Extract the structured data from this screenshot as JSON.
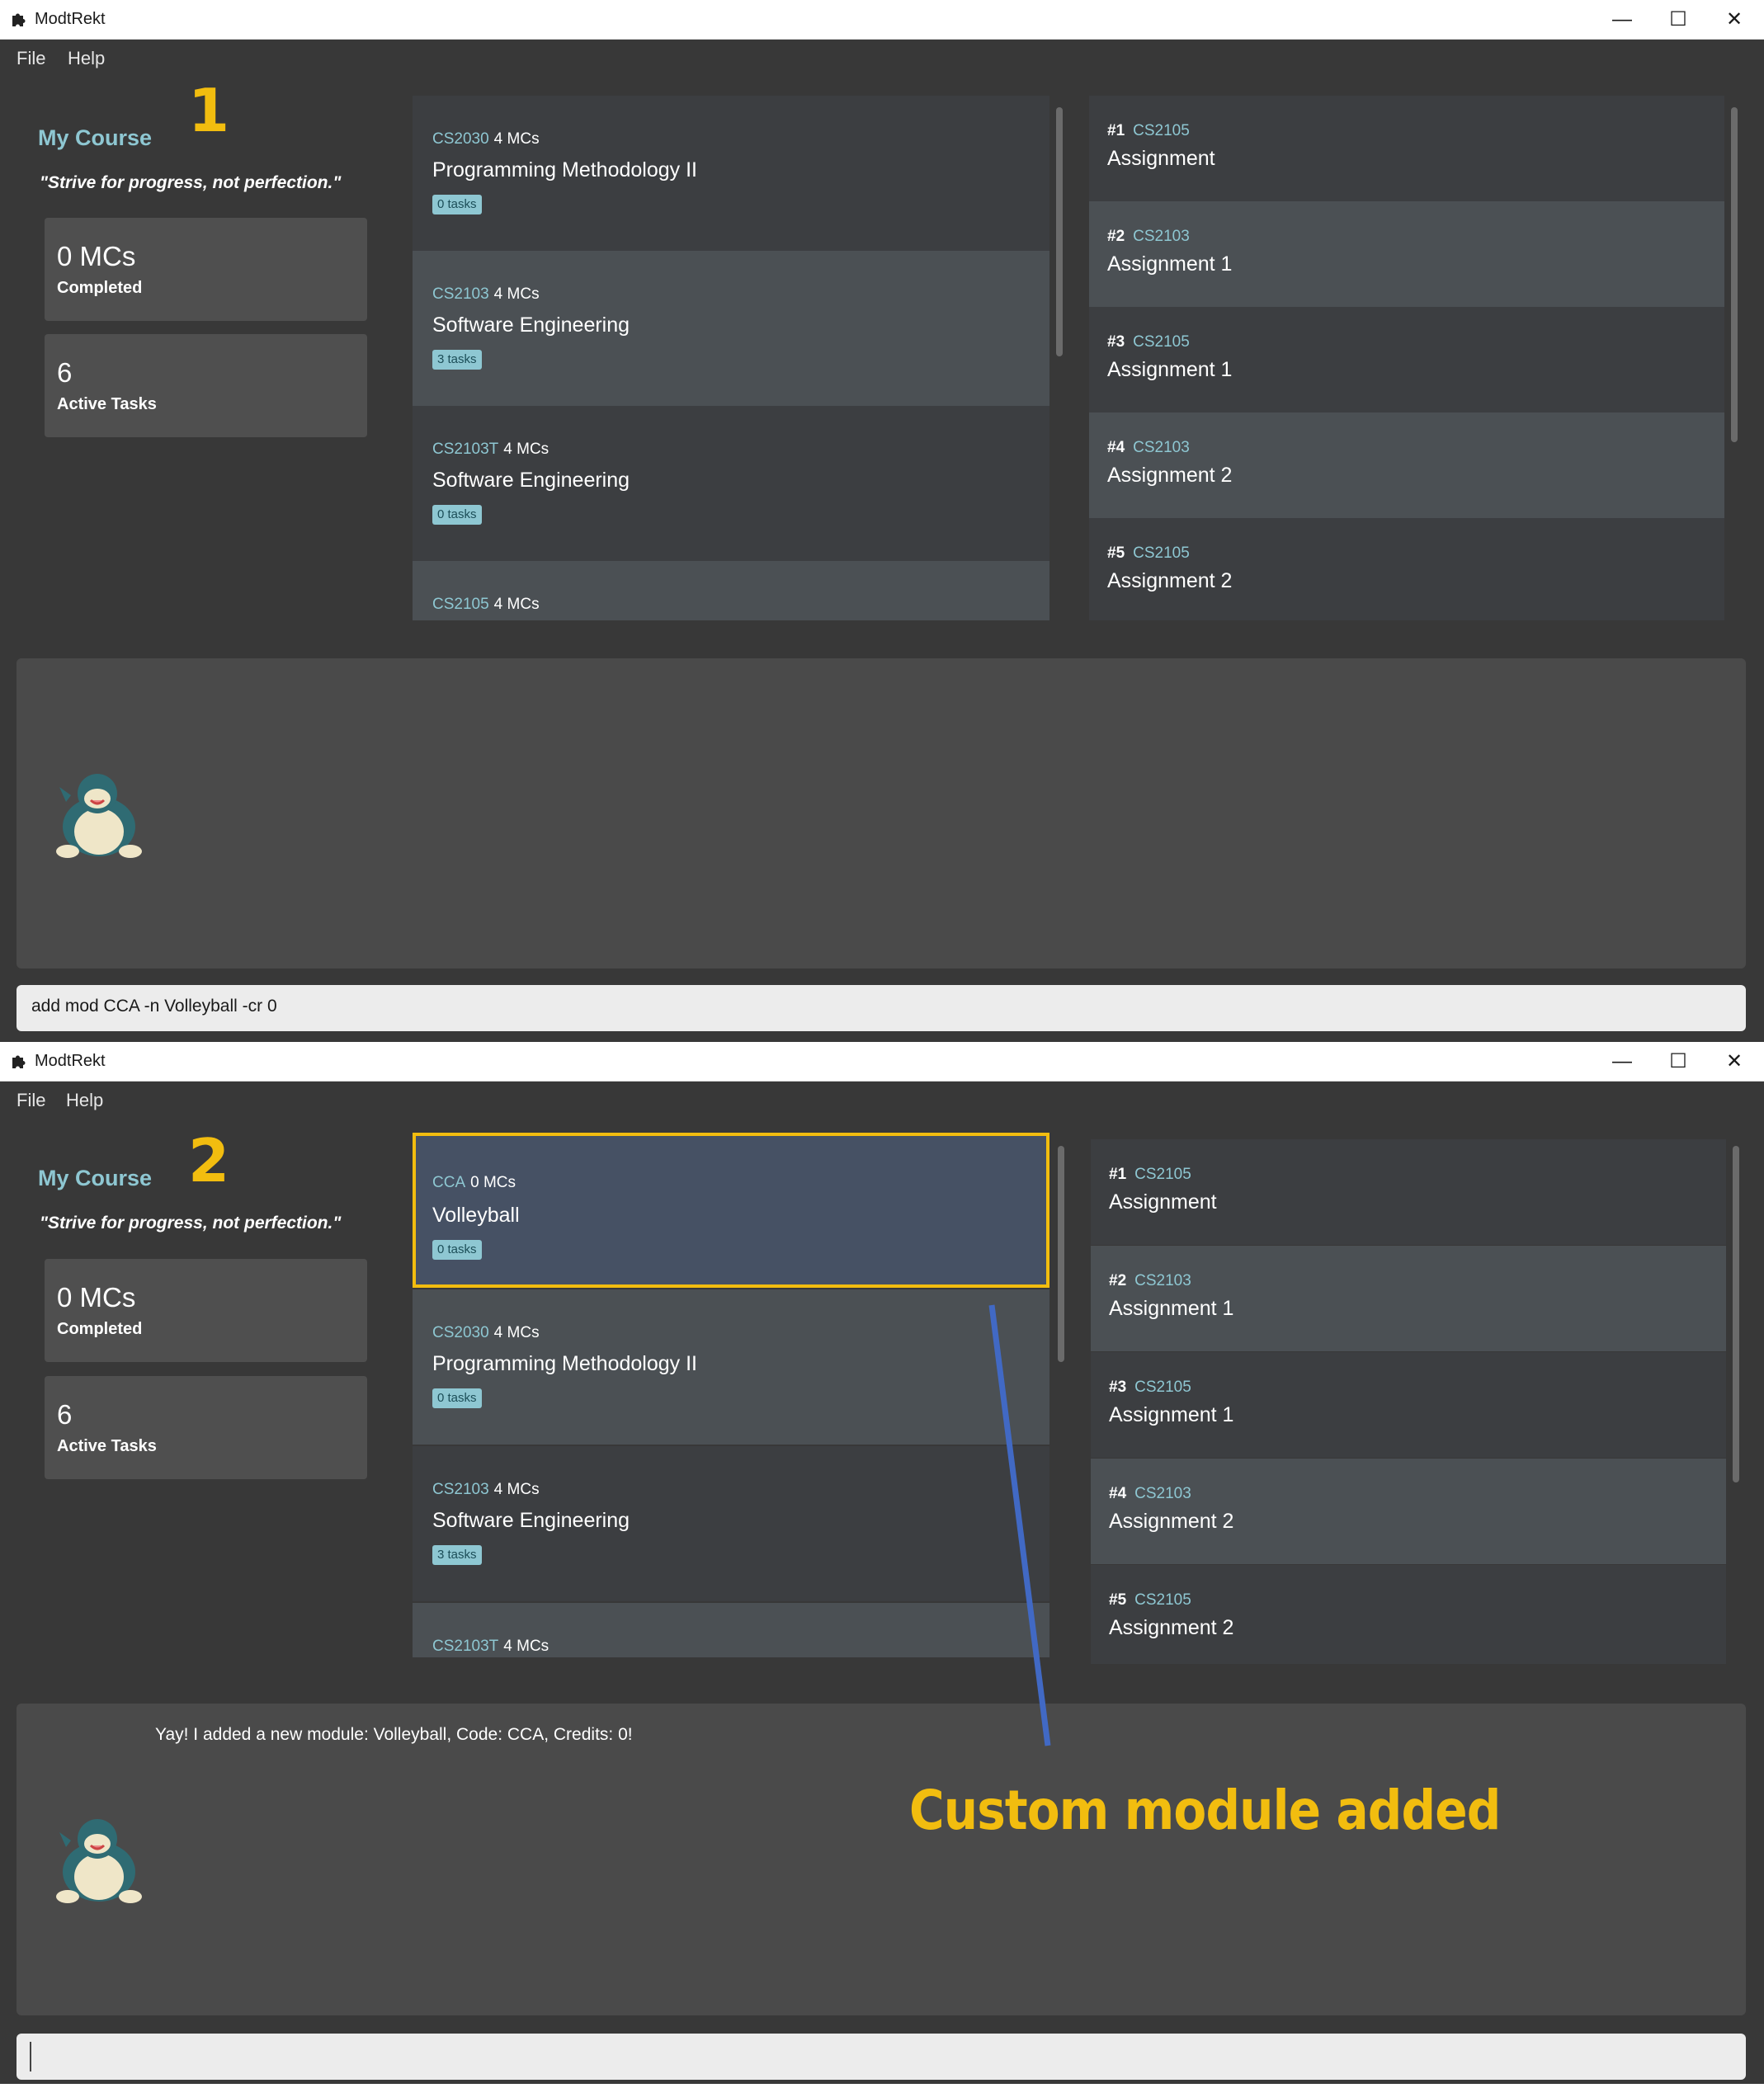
{
  "window": {
    "title": "ModtRekt",
    "minimize_glyph": "—",
    "maximize_glyph": "☐",
    "close_glyph": "✕"
  },
  "menu": {
    "file": "File",
    "help": "Help"
  },
  "sidebar": {
    "title": "My Course",
    "quote": "\"Strive for progress, not perfection.\"",
    "mcs_value": "0 MCs",
    "mcs_label": "Completed",
    "tasks_value": "6",
    "tasks_label": "Active Tasks"
  },
  "steps": {
    "first": "1",
    "second": "2"
  },
  "screen1": {
    "modules": [
      {
        "code": "CS2030",
        "mcs": "4 MCs",
        "name": "Programming Methodology II",
        "tag": "0 tasks"
      },
      {
        "code": "CS2103",
        "mcs": "4 MCs",
        "name": "Software Engineering",
        "tag": "3 tasks"
      },
      {
        "code": "CS2103T",
        "mcs": "4 MCs",
        "name": "Software Engineering",
        "tag": "0 tasks"
      },
      {
        "code": "CS2105",
        "mcs": "4 MCs",
        "name": "",
        "tag": ""
      }
    ],
    "result": "",
    "command": "add mod CCA -n Volleyball -cr 0"
  },
  "screen2": {
    "modules": [
      {
        "code": "CCA",
        "mcs": "0 MCs",
        "name": "Volleyball",
        "tag": "0 tasks"
      },
      {
        "code": "CS2030",
        "mcs": "4 MCs",
        "name": "Programming Methodology II",
        "tag": "0 tasks"
      },
      {
        "code": "CS2103",
        "mcs": "4 MCs",
        "name": "Software Engineering",
        "tag": "3 tasks"
      },
      {
        "code": "CS2103T",
        "mcs": "4 MCs",
        "name": "",
        "tag": ""
      }
    ],
    "result": "Yay! I added a new module: Volleyball, Code: CCA, Credits: 0!",
    "command": ""
  },
  "tasks": [
    {
      "num": "#1",
      "code": "CS2105",
      "name": "Assignment"
    },
    {
      "num": "#2",
      "code": "CS2103",
      "name": "Assignment 1"
    },
    {
      "num": "#3",
      "code": "CS2105",
      "name": "Assignment 1"
    },
    {
      "num": "#4",
      "code": "CS2103",
      "name": "Assignment 2"
    },
    {
      "num": "#5",
      "code": "CS2105",
      "name": "Assignment 2"
    }
  ],
  "annotation": {
    "label": "Custom module added"
  },
  "colors": {
    "accent_yellow": "#f2bd0f",
    "accent_teal": "#8ec7d2",
    "arrow_blue": "#4169c4",
    "background": "#383838"
  },
  "icons": {
    "app": "puzzle-icon",
    "mascot": "snorlax-mascot-icon"
  }
}
